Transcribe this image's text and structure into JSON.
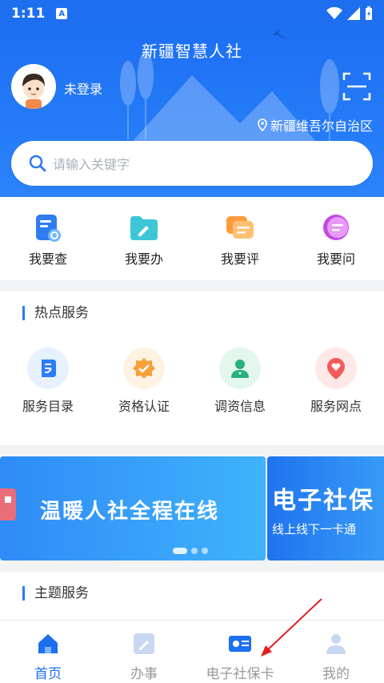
{
  "status": {
    "time": "1:11",
    "notif": "A"
  },
  "header": {
    "title": "新疆智慧人社",
    "login_label": "未登录",
    "location": "新疆维吾尔自治区"
  },
  "search": {
    "placeholder": "请输入关键字"
  },
  "quick_actions": [
    {
      "label": "我要查",
      "icon": "search-doc-icon"
    },
    {
      "label": "我要办",
      "icon": "folder-pen-icon"
    },
    {
      "label": "我要评",
      "icon": "comment-icon"
    },
    {
      "label": "我要问",
      "icon": "chat-bubble-icon"
    }
  ],
  "hot_services": {
    "title": "热点服务",
    "items": [
      {
        "label": "服务目录",
        "icon": "catalog-icon",
        "color": "#2b7cf6",
        "bg": "#e8f1ff"
      },
      {
        "label": "资格认证",
        "icon": "badge-check-icon",
        "color": "#f5a23a",
        "bg": "#fff2e3"
      },
      {
        "label": "调资信息",
        "icon": "person-icon",
        "color": "#27b07e",
        "bg": "#e4f7ef"
      },
      {
        "label": "服务网点",
        "icon": "location-heart-icon",
        "color": "#f25a5a",
        "bg": "#ffe9e8"
      }
    ]
  },
  "banner": {
    "slide1_text": "温暖人社全程在线",
    "slide2_title": "电子社保",
    "slide2_sub": "线上线下一卡通"
  },
  "theme_services": {
    "title": "主题服务"
  },
  "bottom_nav": [
    {
      "label": "首页",
      "icon": "home-icon",
      "active": true
    },
    {
      "label": "办事",
      "icon": "edit-icon",
      "active": false
    },
    {
      "label": "电子社保卡",
      "icon": "card-icon",
      "active": false
    },
    {
      "label": "我的",
      "icon": "user-icon",
      "active": false
    }
  ],
  "colors": {
    "primary": "#1e6ff0",
    "accent_red": "#e02020"
  }
}
